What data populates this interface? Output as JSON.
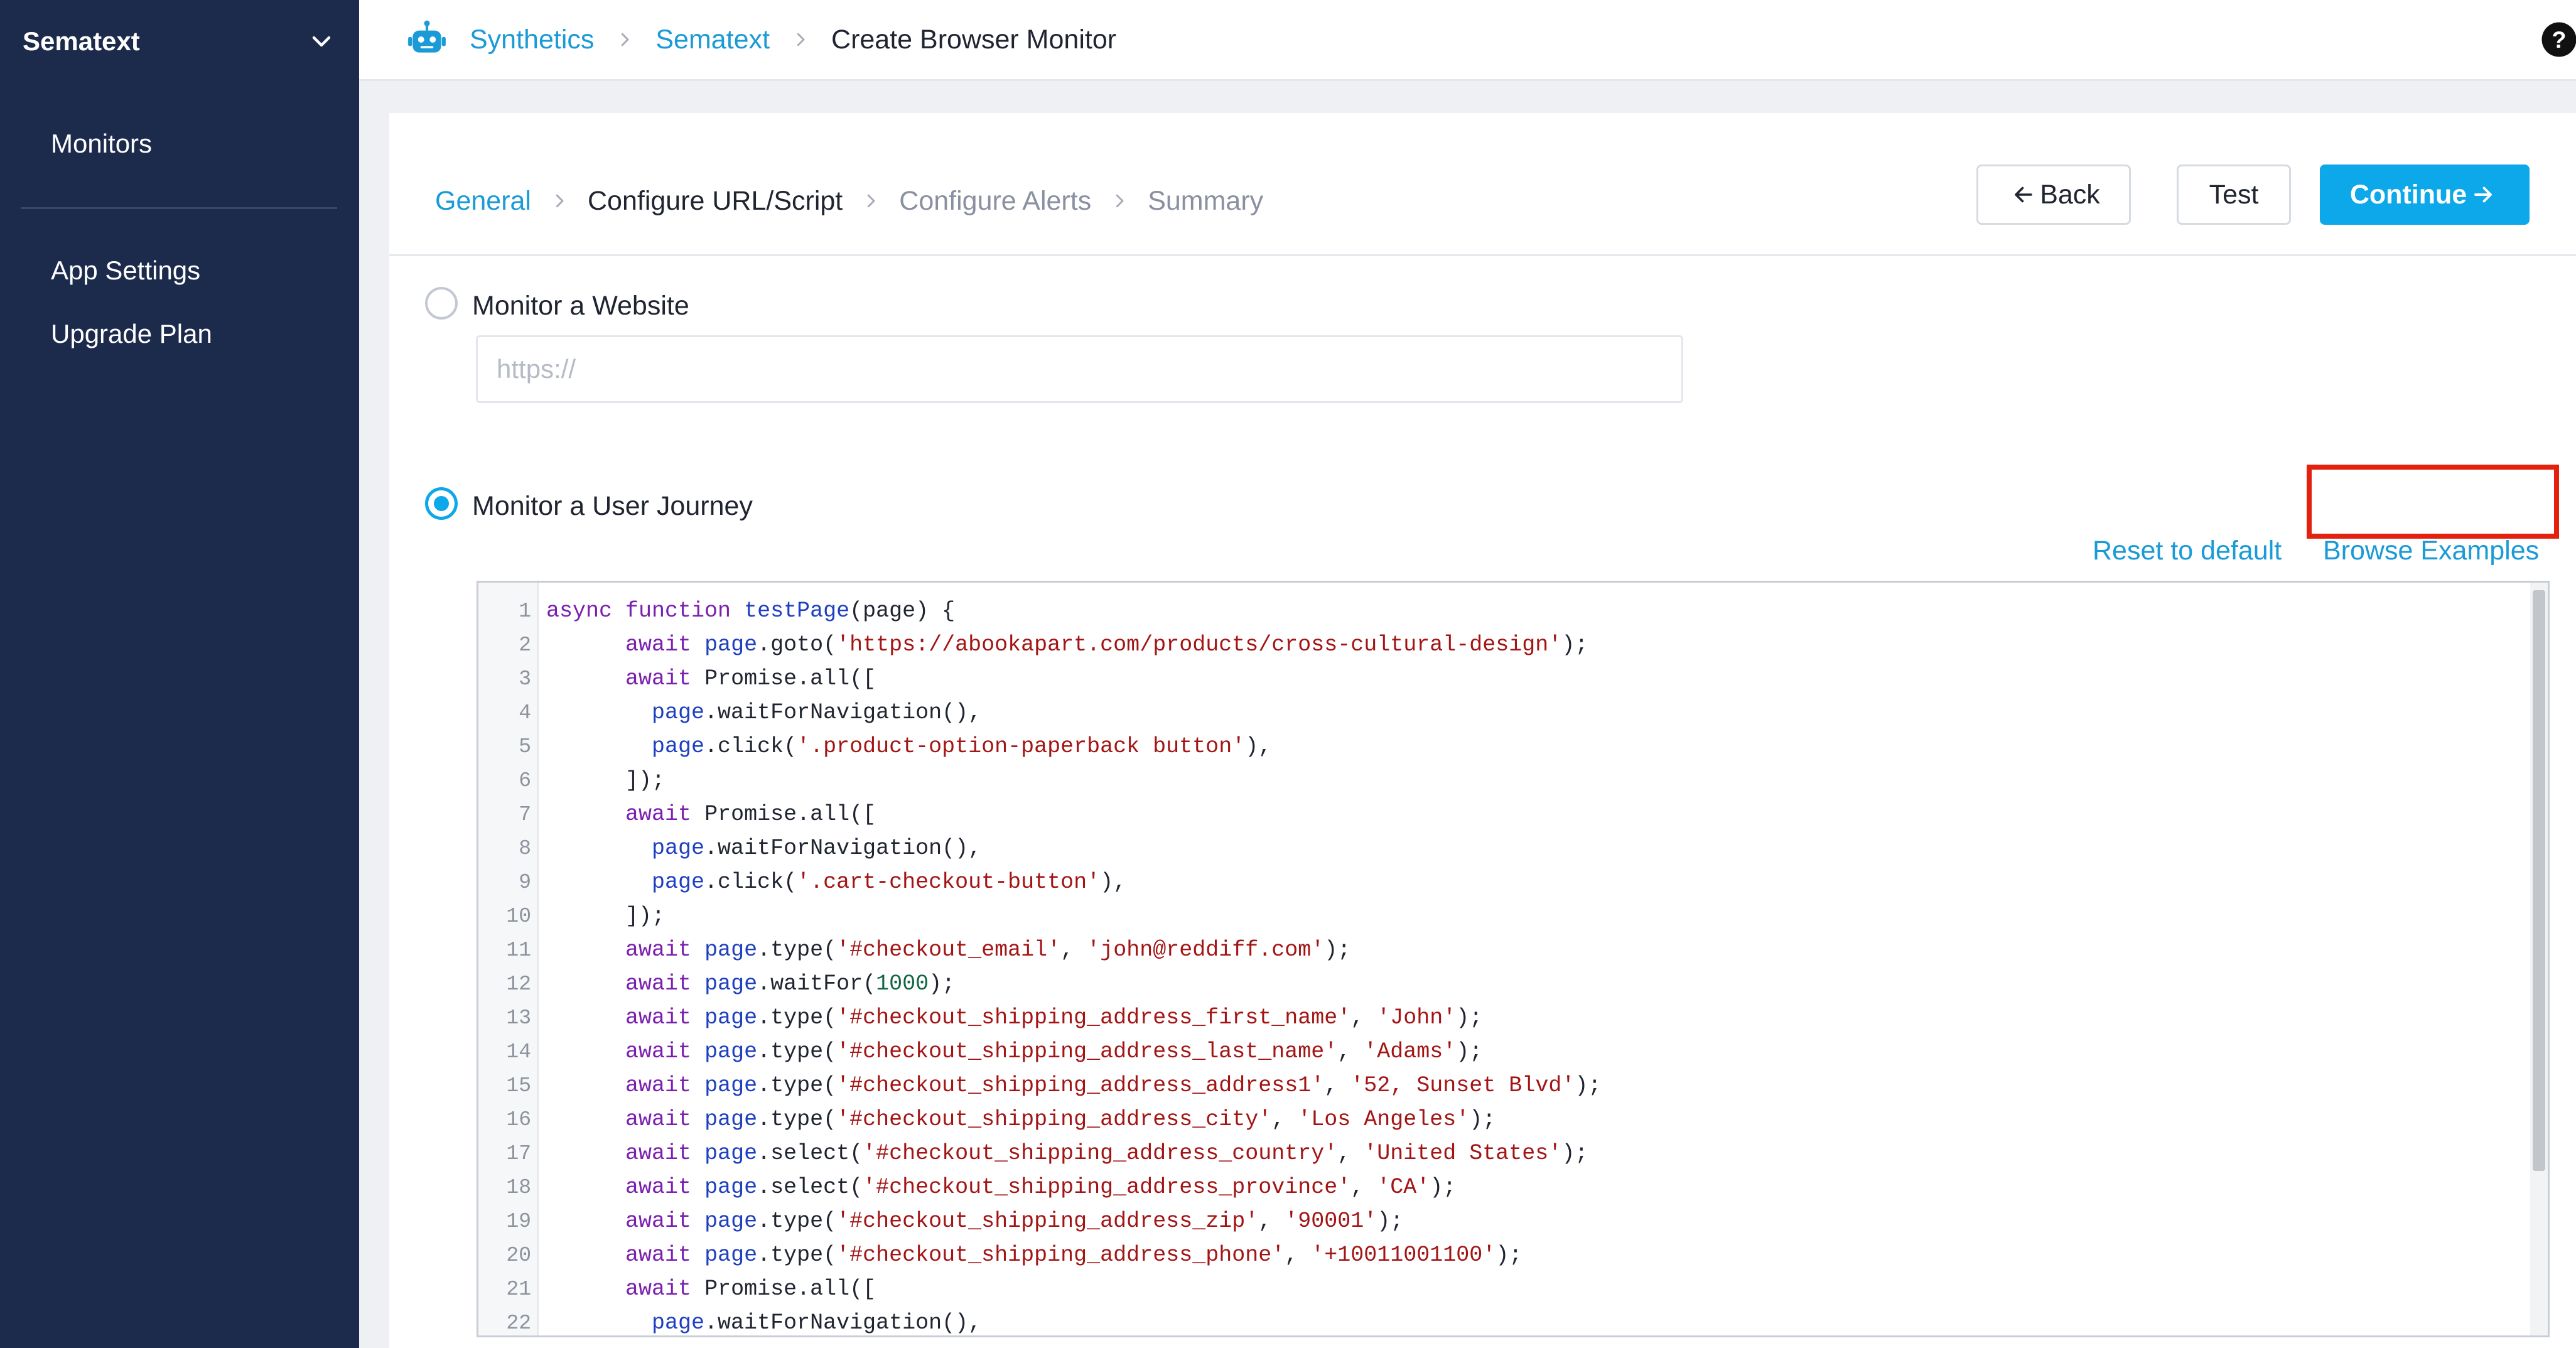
{
  "sidebar": {
    "workspace": "Sematext",
    "items": [
      {
        "label": "Monitors"
      },
      {
        "label": "App Settings"
      },
      {
        "label": "Upgrade Plan"
      }
    ]
  },
  "header": {
    "breadcrumbs": [
      {
        "label": "Synthetics",
        "link": true
      },
      {
        "label": "Sematext",
        "link": true
      },
      {
        "label": "Create Browser Monitor",
        "link": false
      }
    ]
  },
  "steps": [
    {
      "label": "General",
      "state": "done"
    },
    {
      "label": "Configure URL/Script",
      "state": "active"
    },
    {
      "label": "Configure Alerts",
      "state": "future"
    },
    {
      "label": "Summary",
      "state": "future"
    }
  ],
  "buttons": {
    "back": "Back",
    "test": "Test",
    "continue": "Continue"
  },
  "website_option": {
    "label": "Monitor a Website",
    "selected": false,
    "placeholder": "https://",
    "value": ""
  },
  "journey_option": {
    "label": "Monitor a User Journey",
    "selected": true,
    "reset_label": "Reset to default",
    "browse_label": "Browse Examples"
  },
  "colors": {
    "sidebar_bg": "#1c2b4c",
    "accent": "#0ca8ea",
    "link": "#1a9ad6",
    "highlight": "#e2220f"
  },
  "code_lines": [
    [
      [
        "kw",
        "async "
      ],
      [
        "kw",
        "function "
      ],
      [
        "fn",
        "testPage"
      ],
      [
        "pl",
        "(page) {"
      ]
    ],
    [
      [
        "pl",
        "      "
      ],
      [
        "kw",
        "await "
      ],
      [
        "obj",
        "page"
      ],
      [
        "pl",
        ".goto("
      ],
      [
        "str",
        "'https://abookapart.com/products/cross-cultural-design'"
      ],
      [
        "pl",
        ");"
      ]
    ],
    [
      [
        "pl",
        "      "
      ],
      [
        "kw",
        "await "
      ],
      [
        "pl",
        "Promise.all(["
      ]
    ],
    [
      [
        "pl",
        "        "
      ],
      [
        "obj",
        "page"
      ],
      [
        "pl",
        ".waitForNavigation(),"
      ]
    ],
    [
      [
        "pl",
        "        "
      ],
      [
        "obj",
        "page"
      ],
      [
        "pl",
        ".click("
      ],
      [
        "str",
        "'.product-option-paperback button'"
      ],
      [
        "pl",
        "),"
      ]
    ],
    [
      [
        "pl",
        "      ]);"
      ]
    ],
    [
      [
        "pl",
        "      "
      ],
      [
        "kw",
        "await "
      ],
      [
        "pl",
        "Promise.all(["
      ]
    ],
    [
      [
        "pl",
        "        "
      ],
      [
        "obj",
        "page"
      ],
      [
        "pl",
        ".waitForNavigation(),"
      ]
    ],
    [
      [
        "pl",
        "        "
      ],
      [
        "obj",
        "page"
      ],
      [
        "pl",
        ".click("
      ],
      [
        "str",
        "'.cart-checkout-button'"
      ],
      [
        "pl",
        "),"
      ]
    ],
    [
      [
        "pl",
        "      ]);"
      ]
    ],
    [
      [
        "pl",
        "      "
      ],
      [
        "kw",
        "await "
      ],
      [
        "obj",
        "page"
      ],
      [
        "pl",
        ".type("
      ],
      [
        "str",
        "'#checkout_email'"
      ],
      [
        "pl",
        ", "
      ],
      [
        "str",
        "'john@reddiff.com'"
      ],
      [
        "pl",
        ");"
      ]
    ],
    [
      [
        "pl",
        "      "
      ],
      [
        "kw",
        "await "
      ],
      [
        "obj",
        "page"
      ],
      [
        "pl",
        ".waitFor("
      ],
      [
        "num",
        "1000"
      ],
      [
        "pl",
        ");"
      ]
    ],
    [
      [
        "pl",
        "      "
      ],
      [
        "kw",
        "await "
      ],
      [
        "obj",
        "page"
      ],
      [
        "pl",
        ".type("
      ],
      [
        "str",
        "'#checkout_shipping_address_first_name'"
      ],
      [
        "pl",
        ", "
      ],
      [
        "str",
        "'John'"
      ],
      [
        "pl",
        ");"
      ]
    ],
    [
      [
        "pl",
        "      "
      ],
      [
        "kw",
        "await "
      ],
      [
        "obj",
        "page"
      ],
      [
        "pl",
        ".type("
      ],
      [
        "str",
        "'#checkout_shipping_address_last_name'"
      ],
      [
        "pl",
        ", "
      ],
      [
        "str",
        "'Adams'"
      ],
      [
        "pl",
        ");"
      ]
    ],
    [
      [
        "pl",
        "      "
      ],
      [
        "kw",
        "await "
      ],
      [
        "obj",
        "page"
      ],
      [
        "pl",
        ".type("
      ],
      [
        "str",
        "'#checkout_shipping_address_address1'"
      ],
      [
        "pl",
        ", "
      ],
      [
        "str",
        "'52, Sunset Blvd'"
      ],
      [
        "pl",
        ");"
      ]
    ],
    [
      [
        "pl",
        "      "
      ],
      [
        "kw",
        "await "
      ],
      [
        "obj",
        "page"
      ],
      [
        "pl",
        ".type("
      ],
      [
        "str",
        "'#checkout_shipping_address_city'"
      ],
      [
        "pl",
        ", "
      ],
      [
        "str",
        "'Los Angeles'"
      ],
      [
        "pl",
        ");"
      ]
    ],
    [
      [
        "pl",
        "      "
      ],
      [
        "kw",
        "await "
      ],
      [
        "obj",
        "page"
      ],
      [
        "pl",
        ".select("
      ],
      [
        "str",
        "'#checkout_shipping_address_country'"
      ],
      [
        "pl",
        ", "
      ],
      [
        "str",
        "'United States'"
      ],
      [
        "pl",
        ");"
      ]
    ],
    [
      [
        "pl",
        "      "
      ],
      [
        "kw",
        "await "
      ],
      [
        "obj",
        "page"
      ],
      [
        "pl",
        ".select("
      ],
      [
        "str",
        "'#checkout_shipping_address_province'"
      ],
      [
        "pl",
        ", "
      ],
      [
        "str",
        "'CA'"
      ],
      [
        "pl",
        ");"
      ]
    ],
    [
      [
        "pl",
        "      "
      ],
      [
        "kw",
        "await "
      ],
      [
        "obj",
        "page"
      ],
      [
        "pl",
        ".type("
      ],
      [
        "str",
        "'#checkout_shipping_address_zip'"
      ],
      [
        "pl",
        ", "
      ],
      [
        "str",
        "'90001'"
      ],
      [
        "pl",
        ");"
      ]
    ],
    [
      [
        "pl",
        "      "
      ],
      [
        "kw",
        "await "
      ],
      [
        "obj",
        "page"
      ],
      [
        "pl",
        ".type("
      ],
      [
        "str",
        "'#checkout_shipping_address_phone'"
      ],
      [
        "pl",
        ", "
      ],
      [
        "str",
        "'+10011001100'"
      ],
      [
        "pl",
        ");"
      ]
    ],
    [
      [
        "pl",
        "      "
      ],
      [
        "kw",
        "await "
      ],
      [
        "pl",
        "Promise.all(["
      ]
    ],
    [
      [
        "pl",
        "        "
      ],
      [
        "obj",
        "page"
      ],
      [
        "pl",
        ".waitForNavigation(),"
      ]
    ]
  ]
}
